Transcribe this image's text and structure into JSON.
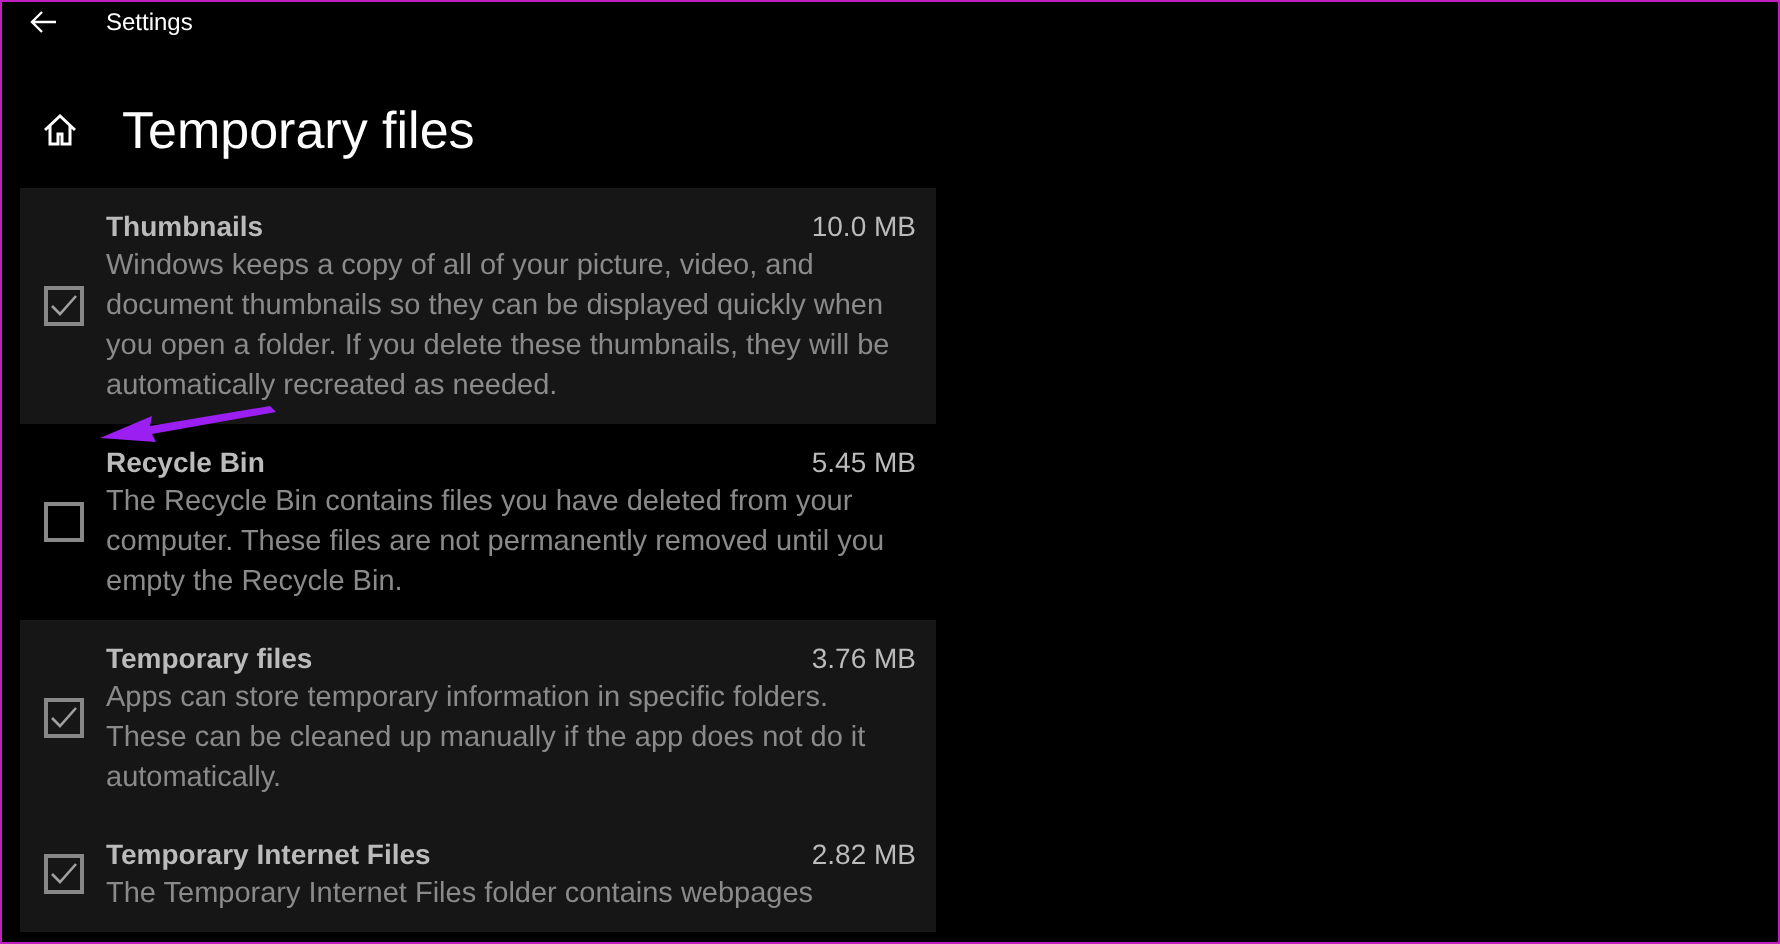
{
  "window": {
    "title": "Settings"
  },
  "page": {
    "title": "Temporary files"
  },
  "items": [
    {
      "name": "Thumbnails",
      "size": "10.0 MB",
      "description": "Windows keeps a copy of all of your picture, video, and document thumbnails so they can be displayed quickly when you open a folder. If you delete these thumbnails, they will be automatically recreated as needed.",
      "checked": true
    },
    {
      "name": "Recycle Bin",
      "size": "5.45 MB",
      "description": "The Recycle Bin contains files you have deleted from your computer. These files are not permanently removed until you empty the Recycle Bin.",
      "checked": false
    },
    {
      "name": "Temporary files",
      "size": "3.76 MB",
      "description": "Apps can store temporary information in specific folders. These can be cleaned up manually if the app does not do it automatically.",
      "checked": true
    },
    {
      "name": "Temporary Internet Files",
      "size": "2.82 MB",
      "description": "The Temporary Internet Files folder contains webpages",
      "checked": true
    }
  ]
}
